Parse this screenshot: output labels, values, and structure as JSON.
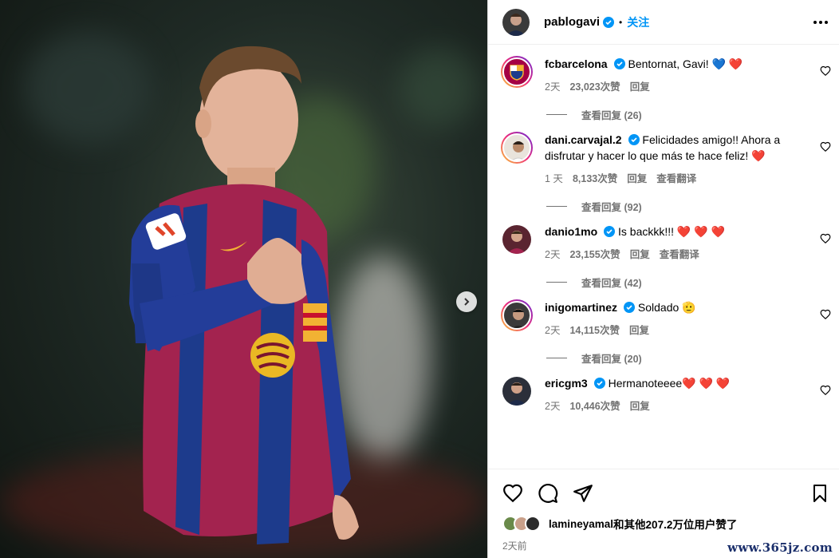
{
  "post": {
    "author": "pablogavi",
    "follow_label": "关注",
    "dot": "•"
  },
  "comments": [
    {
      "user": "fcbarcelona",
      "text": "Bentornat, Gavi! 💙 ❤️",
      "time": "2天",
      "likes": "23,023次赞",
      "reply": "回复",
      "translate": "",
      "replies": "查看回复 (26)",
      "avatar_color": "#a50044"
    },
    {
      "user": "dani.carvajal.2",
      "text": "Felicidades amigo!! Ahora a disfrutar y hacer lo que más te hace feliz! ❤️",
      "time": "1 天",
      "likes": "8,133次赞",
      "reply": "回复",
      "translate": "查看翻译",
      "replies": "查看回复 (92)",
      "avatar_color": "#e9e4dc"
    },
    {
      "user": "danio1mo",
      "text": "Is backkk!!! ❤️ ❤️ ❤️",
      "time": "2天",
      "likes": "23,155次赞",
      "reply": "回复",
      "translate": "查看翻译",
      "replies": "查看回复 (42)",
      "avatar_color": "#5a2430"
    },
    {
      "user": "inigomartinez",
      "text": "Soldado 🫡",
      "time": "2天",
      "likes": "14,115次赞",
      "reply": "回复",
      "translate": "",
      "replies": "查看回复 (20)",
      "avatar_color": "#3a3a3a"
    },
    {
      "user": "ericgm3",
      "text": "Hermanoteeee❤️ ❤️ ❤️",
      "time": "2天",
      "likes": "10,446次赞",
      "reply": "回复",
      "translate": "",
      "replies": "",
      "avatar_color": "#2b2f3a"
    }
  ],
  "likes": {
    "user": "lamineyamal",
    "rest": "和其他207.2万位用户赞了"
  },
  "date": "2天前",
  "watermark": "www.365jz.com",
  "colors": {
    "accent": "#0095f6",
    "heart": "#ed4956",
    "meta": "#737373"
  }
}
